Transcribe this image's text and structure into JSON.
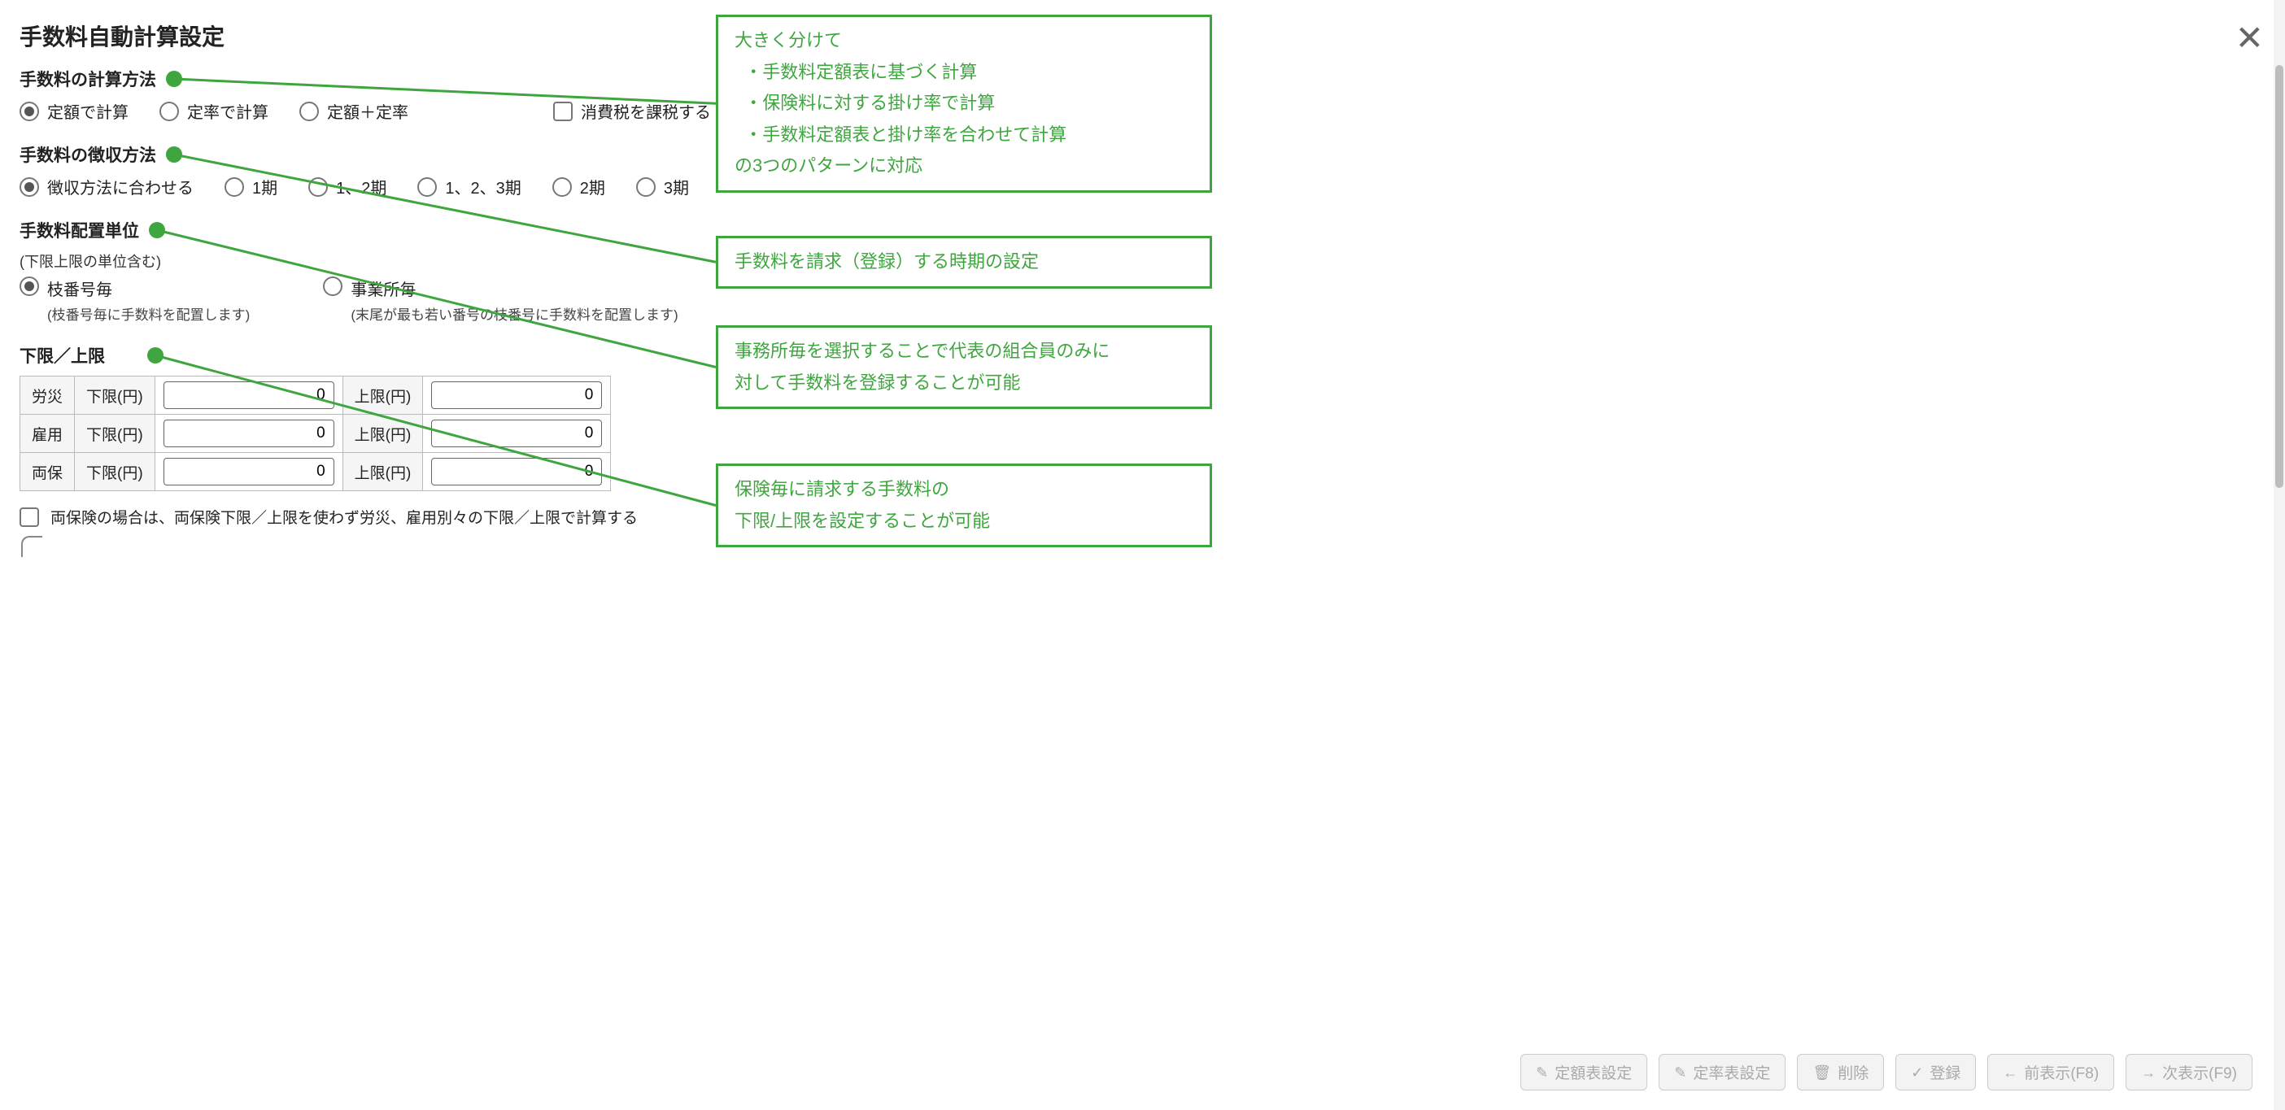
{
  "title": "手数料自動計算設定",
  "close_symbol": "✕",
  "sections": {
    "calc_method": {
      "title": "手数料の計算方法",
      "options": [
        "定額で計算",
        "定率で計算",
        "定額＋定率"
      ],
      "tax_checkbox": "消費税を課税する"
    },
    "collect_method": {
      "title": "手数料の徴収方法",
      "options": [
        "徴収方法に合わせる",
        "1期",
        "1、2期",
        "1、2、3期",
        "2期",
        "3期"
      ]
    },
    "placement_unit": {
      "title": "手数料配置単位",
      "sub": "(下限上限の単位含む)",
      "options": [
        {
          "label": "枝番号毎",
          "help": "(枝番号毎に手数料を配置します)"
        },
        {
          "label": "事業所毎",
          "help": "(末尾が最も若い番号の枝番号に手数料を配置します)"
        }
      ]
    },
    "limits": {
      "title": "下限／上限",
      "rows": [
        {
          "name": "労災",
          "low_label": "下限(円)",
          "low_value": "0",
          "high_label": "上限(円)",
          "high_value": "0"
        },
        {
          "name": "雇用",
          "low_label": "下限(円)",
          "low_value": "0",
          "high_label": "上限(円)",
          "high_value": "0"
        },
        {
          "name": "両保",
          "low_label": "下限(円)",
          "low_value": "0",
          "high_label": "上限(円)",
          "high_value": "0"
        }
      ],
      "both_note": "両保険の場合は、両保険下限／上限を使わず労災、雇用別々の下限／上限で計算する"
    }
  },
  "buttons": {
    "fixed_table": "定額表設定",
    "rate_table": "定率表設定",
    "delete": "削除",
    "register": "登録",
    "prev": "前表示(F8)",
    "next": "次表示(F9)"
  },
  "callouts": {
    "c1": "大きく分けて\n  ・手数料定額表に基づく計算\n  ・保険料に対する掛け率で計算\n  ・手数料定額表と掛け率を合わせて計算\nの3つのパターンに対応",
    "c2": "手数料を請求（登録）する時期の設定",
    "c3": "事務所毎を選択することで代表の組合員のみに\n対して手数料を登録することが可能",
    "c4": "保険毎に請求する手数料の\n下限/上限を設定することが可能"
  }
}
